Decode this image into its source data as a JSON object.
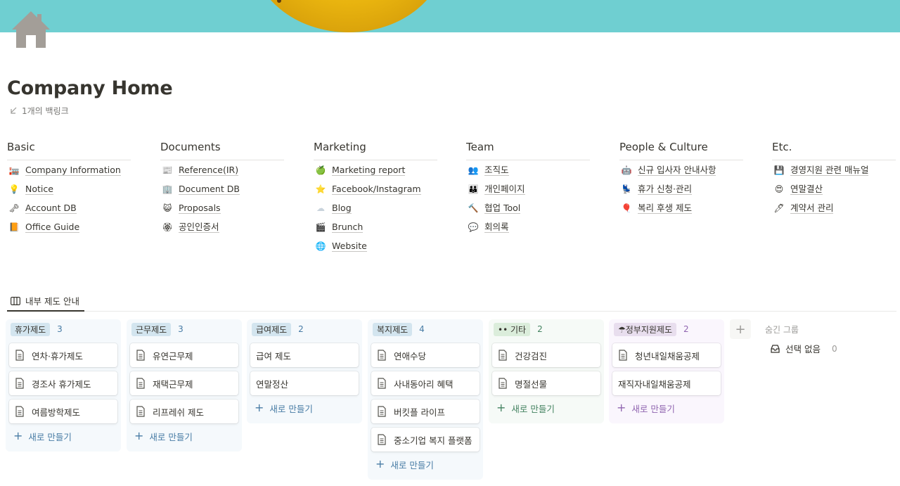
{
  "page": {
    "title": "Company Home",
    "backlinks": "1개의 백링크",
    "icons": {
      "page_icon": "home-icon",
      "backlink_icon": "arrow-down-left-icon"
    }
  },
  "link_columns": [
    {
      "heading": "Basic",
      "items": [
        {
          "label": "Company Information",
          "icon": "building-icon",
          "glyph": "🏣"
        },
        {
          "label": "Notice",
          "icon": "lightbulb-icon",
          "glyph": "💡"
        },
        {
          "label": "Account DB",
          "icon": "key-icon",
          "glyph": "🗝"
        },
        {
          "label": "Office Guide",
          "icon": "book-icon",
          "glyph": "📙"
        }
      ]
    },
    {
      "heading": "Documents",
      "items": [
        {
          "label": "Reference(IR)",
          "icon": "newspaper-icon",
          "glyph": "📰"
        },
        {
          "label": "Document DB",
          "icon": "office-building-icon",
          "glyph": "🏢"
        },
        {
          "label": "Proposals",
          "icon": "cat-icon",
          "glyph": "😺"
        },
        {
          "label": "공인인증서",
          "icon": "certificate-icon",
          "glyph": "🏵"
        }
      ]
    },
    {
      "heading": "Marketing",
      "items": [
        {
          "label": "Marketing report",
          "icon": "apple-icon",
          "glyph": "🍏"
        },
        {
          "label": "Facebook/Instagram",
          "icon": "star-icon",
          "glyph": "⭐"
        },
        {
          "label": "Blog",
          "icon": "cloud-icon",
          "glyph": "☁"
        },
        {
          "label": "Brunch",
          "icon": "clapper-icon",
          "glyph": "🎬"
        },
        {
          "label": "Website",
          "icon": "globe-icon",
          "glyph": "🌐"
        }
      ]
    },
    {
      "heading": "Team",
      "items": [
        {
          "label": "조직도",
          "icon": "people-icon",
          "glyph": "👥"
        },
        {
          "label": "개인페이지",
          "icon": "family-icon",
          "glyph": "👪"
        },
        {
          "label": "협업 Tool",
          "icon": "hammer-icon",
          "glyph": "🔨"
        },
        {
          "label": "회의록",
          "icon": "speech-bubble-icon",
          "glyph": "💬"
        }
      ]
    },
    {
      "heading": "People & Culture",
      "items": [
        {
          "label": "신규 입사자 안내사항",
          "icon": "robot-icon",
          "glyph": "🤖"
        },
        {
          "label": "휴가 신청·관리",
          "icon": "chair-icon",
          "glyph": "💺"
        },
        {
          "label": "복리 후생 제도",
          "icon": "balloon-icon",
          "glyph": "🎈"
        }
      ]
    },
    {
      "heading": "Etc.",
      "items": [
        {
          "label": "경영지원 관련 매뉴얼",
          "icon": "floppy-disk-icon",
          "glyph": "💾"
        },
        {
          "label": "연말결산",
          "icon": "heart-eyes-icon",
          "glyph": "😍"
        },
        {
          "label": "계약서 관리",
          "icon": "pen-icon",
          "glyph": "🖊"
        }
      ]
    }
  ],
  "database": {
    "view_tab": "내부 제도 안내",
    "view_icon": "board-view-icon",
    "new_label": "새로 만들기",
    "groups": [
      {
        "name": "휴가제도",
        "count": "3",
        "bg": "#f5f9fc",
        "tag": "#d3e5ef",
        "text": "#487ca5",
        "cards": [
          "연차·휴가제도",
          "경조사 휴가제도",
          "여름방학제도"
        ],
        "doc_icons": true
      },
      {
        "name": "근무제도",
        "count": "3",
        "bg": "#f5f9fc",
        "tag": "#d3e5ef",
        "text": "#487ca5",
        "cards": [
          "유연근무제",
          "재택근무제",
          "리프레쉬 제도"
        ],
        "doc_icons": true
      },
      {
        "name": "급여제도",
        "count": "2",
        "bg": "#f5f9fc",
        "tag": "#d3e5ef",
        "text": "#487ca5",
        "cards": [
          "급여 제도",
          "연말정산"
        ],
        "doc_icons": false
      },
      {
        "name": "복지제도",
        "count": "4",
        "bg": "#f5f9fc",
        "tag": "#d3e5ef",
        "text": "#487ca5",
        "cards": [
          "연애수당",
          "사내동아리 혜택",
          "버킷플 라이프",
          "중소기업 복지 플랫폼"
        ],
        "doc_icons": true
      },
      {
        "name": "•• 기타",
        "count": "2",
        "bg": "#f6faf7",
        "tag": "#dbeddb",
        "text": "#448361",
        "cards": [
          "건강검진",
          "명절선물"
        ],
        "doc_icons": true
      },
      {
        "name": "☂정부지원제도",
        "count": "2",
        "bg": "#faf6fd",
        "tag": "#e8deee",
        "text": "#9065b0",
        "cards": [
          "청년내일채움공제",
          "재직자내일채움공제"
        ],
        "doc_icons_first_only": true
      }
    ],
    "hidden_groups_title": "숨긴 그룹",
    "hidden_groups": [
      {
        "label": "선택 없음",
        "count": "0",
        "icon": "inbox-icon"
      }
    ],
    "add_group_icon": "plus-icon"
  },
  "colors": {
    "cover": "#6fcfd1",
    "text": "#37352f",
    "muted": "#787774"
  }
}
